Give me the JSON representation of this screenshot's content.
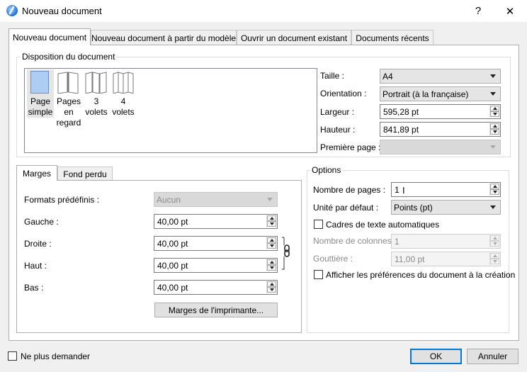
{
  "window": {
    "title": "Nouveau document",
    "help": "?",
    "close": "✕"
  },
  "tabs": [
    "Nouveau document",
    "Nouveau document à partir du modèle",
    "Ouvrir un document existant",
    "Documents récents"
  ],
  "layout_group": {
    "title": "Disposition du document",
    "items": [
      {
        "label": "Page simple",
        "line1": "Page",
        "line2": "simple",
        "line3": ""
      },
      {
        "label": "Pages en regard",
        "line1": "Pages",
        "line2": "en",
        "line3": "regard"
      },
      {
        "label": "3 volets",
        "line1": "3",
        "line2": "volets",
        "line3": ""
      },
      {
        "label": "4 volets",
        "line1": "4",
        "line2": "volets",
        "line3": ""
      }
    ],
    "selected": "Page simple"
  },
  "page_props": {
    "size_label": "Taille :",
    "size_value": "A4",
    "orientation_label": "Orientation :",
    "orientation_value": "Portrait (à la française)",
    "width_label": "Largeur :",
    "width_value": "595,28 pt",
    "height_label": "Hauteur :",
    "height_value": "841,89 pt",
    "first_page_label": "Première page :",
    "first_page_value": ""
  },
  "margins": {
    "tabs": [
      "Marges",
      "Fond perdu"
    ],
    "presets_label": "Formats prédéfinis :",
    "presets_value": "Aucun",
    "left_label": "Gauche :",
    "left_value": "40,00 pt",
    "right_label": "Droite :",
    "right_value": "40,00 pt",
    "top_label": "Haut :",
    "top_value": "40,00 pt",
    "bottom_label": "Bas :",
    "bottom_value": "40,00 pt",
    "printer_button": "Marges de l'imprimante..."
  },
  "options": {
    "title": "Options",
    "pages_label": "Nombre de pages :",
    "pages_value": "1",
    "unit_label": "Unité par défaut :",
    "unit_value": "Points (pt)",
    "auto_frames_label": "Cadres de texte automatiques",
    "columns_label": "Nombre de colonnes :",
    "columns_value": "1",
    "gutter_label": "Gouttière :",
    "gutter_value": "11,00 pt",
    "show_prefs_label": "Afficher les préférences du document à la création"
  },
  "footer": {
    "dont_ask_label": "Ne plus demander",
    "ok": "OK",
    "cancel": "Annuler"
  },
  "colors": {
    "accent": "#0078d7",
    "selected_page": "#aecdf2"
  }
}
